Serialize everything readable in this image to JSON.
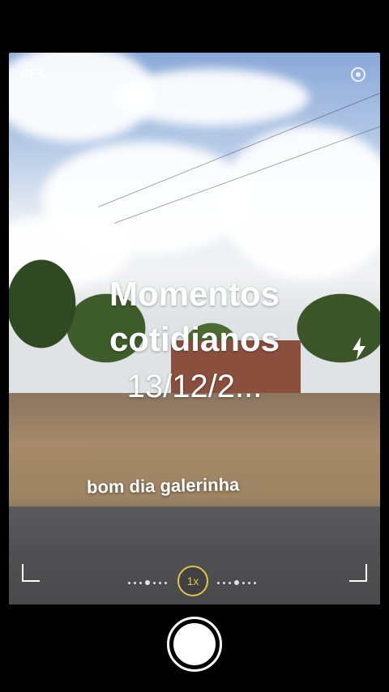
{
  "viewfinder": {
    "rec_label": "REC",
    "title_line1": "Momentos",
    "title_line2": "cotidianos",
    "date_text": "13/12/2...",
    "caption": "bom dia galerinha"
  },
  "controls": {
    "zoom_label": "1x",
    "icons": [
      "settings-icon",
      "flash-icon",
      "shutter-button"
    ],
    "accent_color": "#e2c24a"
  }
}
